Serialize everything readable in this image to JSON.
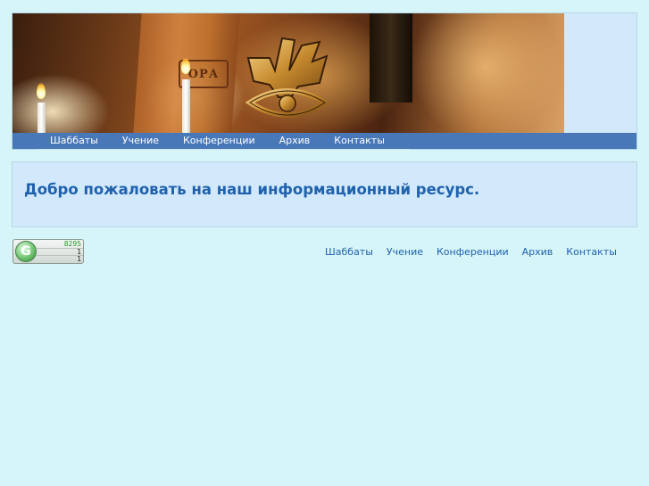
{
  "header": {
    "banner_book_text": "ОРА",
    "menu": [
      "Шаббаты",
      "Учение",
      "Конференции",
      "Архив",
      "Контакты"
    ]
  },
  "welcome": {
    "text": "Добро пожаловать на наш информационный ресурс."
  },
  "counter": {
    "logo_letter": "G",
    "total": "8295",
    "today": "1",
    "online": "1"
  },
  "footer": {
    "links": [
      "Шаббаты",
      "Учение",
      "Конференции",
      "Архив",
      "Контакты"
    ]
  },
  "colors": {
    "background": "#d6f5f9",
    "menubar": "#4978b8",
    "panel": "#d2e9fb",
    "link": "#1f61ad",
    "counter_total": "#22a022"
  }
}
